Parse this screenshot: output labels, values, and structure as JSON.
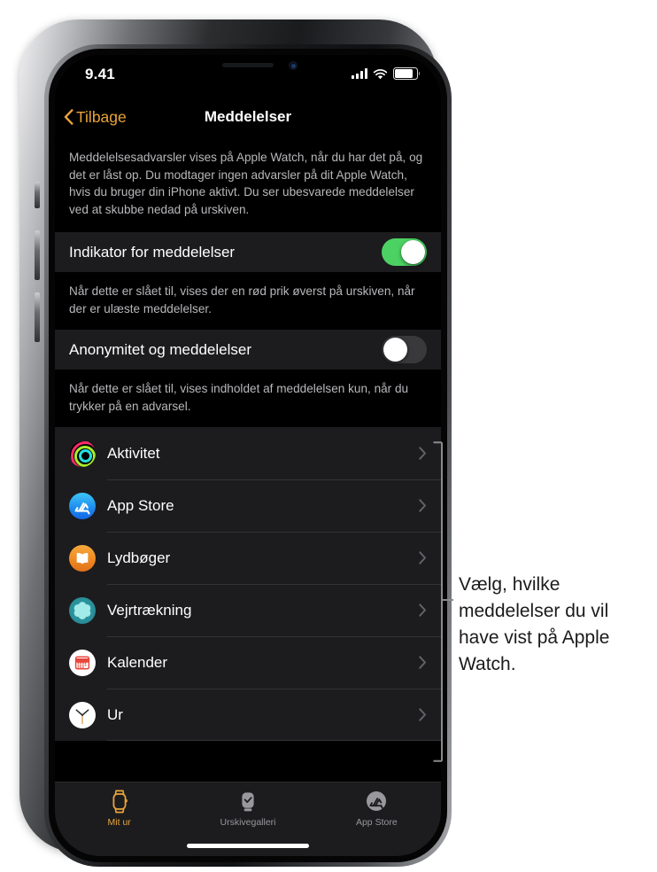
{
  "statusbar": {
    "time": "9.41",
    "signal_icon": "cellular-signal-icon",
    "wifi_icon": "wifi-icon",
    "battery_icon": "battery-icon"
  },
  "navbar": {
    "back_label": "Tilbage",
    "back_icon": "chevron-left-icon",
    "title": "Meddelelser"
  },
  "intro_footnote": "Meddelelsesadvarsler vises på Apple Watch, når du har det på, og det er låst op. Du modtager ingen advarsler på dit Apple Watch, hvis du bruger din iPhone aktivt. Du ser ubesvarede meddelelser ved at skubbe nedad på urskiven.",
  "settings": [
    {
      "label": "Indikator for meddelelser",
      "state": "on",
      "footnote": "Når dette er slået til, vises der en rød prik øverst på urskiven, når der er ulæste meddelelser."
    },
    {
      "label": "Anonymitet og meddelelser",
      "state": "off",
      "footnote": "Når dette er slået til, vises indholdet af meddelelsen kun, når du trykker på en advarsel."
    }
  ],
  "apps": [
    {
      "name": "Aktivitet",
      "icon": "activity-rings-icon",
      "chevron": "chevron-right-icon"
    },
    {
      "name": "App Store",
      "icon": "app-store-icon",
      "chevron": "chevron-right-icon"
    },
    {
      "name": "Lydbøger",
      "icon": "audiobooks-icon",
      "chevron": "chevron-right-icon"
    },
    {
      "name": "Vejrtrækning",
      "icon": "breathe-icon",
      "chevron": "chevron-right-icon"
    },
    {
      "name": "Kalender",
      "icon": "calendar-icon",
      "chevron": "chevron-right-icon"
    },
    {
      "name": "Ur",
      "icon": "clock-icon",
      "chevron": "chevron-right-icon"
    }
  ],
  "tabbar": {
    "tabs": [
      {
        "label": "Mit ur",
        "icon": "apple-watch-icon",
        "active": true
      },
      {
        "label": "Urskivegalleri",
        "icon": "watch-face-icon",
        "active": false
      },
      {
        "label": "App Store",
        "icon": "app-store-icon",
        "active": false
      }
    ]
  },
  "callout": {
    "text": "Vælg, hvilke meddelelser du vil have vist på Apple Watch."
  },
  "colors": {
    "accent_orange": "#e8a33d",
    "toggle_on_green": "#4cd263",
    "toggle_off_gray": "#39393c",
    "cell_background": "#1c1c1e",
    "screen_background": "#000000",
    "footnote_text": "#b8b8bc",
    "callout_line": "#888b8e"
  }
}
